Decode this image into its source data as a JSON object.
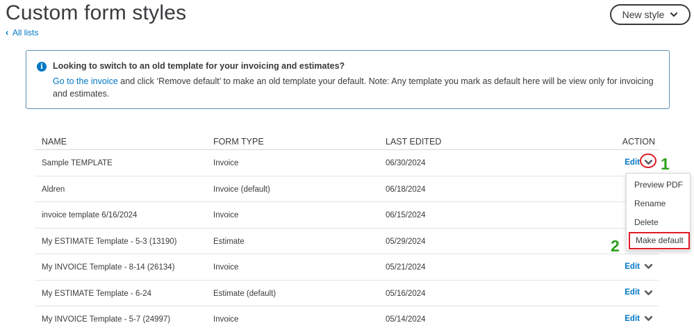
{
  "page": {
    "title": "Custom form styles",
    "back_link": "All lists",
    "new_style_label": "New style"
  },
  "info": {
    "heading": "Looking to switch to an old template for your invoicing and estimates?",
    "link_text": "Go to the invoice",
    "body_text": " and click ‘Remove default’ to make an old template your default. Note: Any template you mark as default here will be view only for invoicing and estimates."
  },
  "table": {
    "headers": {
      "name": "NAME",
      "form_type": "FORM TYPE",
      "last_edited": "LAST EDITED",
      "action": "ACTION"
    },
    "edit_label": "Edit",
    "rows": [
      {
        "name": "Sample TEMPLATE",
        "form_type": "Invoice",
        "last_edited": "06/30/2024"
      },
      {
        "name": "Aldren",
        "form_type": "Invoice (default)",
        "last_edited": "06/18/2024"
      },
      {
        "name": "invoice template 6/16/2024",
        "form_type": "Invoice",
        "last_edited": "06/15/2024"
      },
      {
        "name": "My ESTIMATE Template - 5-3 (13190)",
        "form_type": "Estimate",
        "last_edited": "05/29/2024"
      },
      {
        "name": "My INVOICE Template - 8-14 (26134)",
        "form_type": "Invoice",
        "last_edited": "05/21/2024"
      },
      {
        "name": "My ESTIMATE Template - 6-24",
        "form_type": "Estimate (default)",
        "last_edited": "05/16/2024"
      },
      {
        "name": "My INVOICE Template - 5-7 (24997)",
        "form_type": "Invoice",
        "last_edited": "05/14/2024"
      }
    ]
  },
  "dropdown": {
    "items": [
      "Preview PDF",
      "Rename",
      "Delete",
      "Make default"
    ]
  },
  "annotations": {
    "step1": "1",
    "step2": "2",
    "highlight_color": "#e01b24",
    "number_color": "#2ca01c"
  },
  "colors": {
    "link_blue": "#0077c5",
    "text": "#393a3d",
    "info_border": "#5e8fb0"
  }
}
